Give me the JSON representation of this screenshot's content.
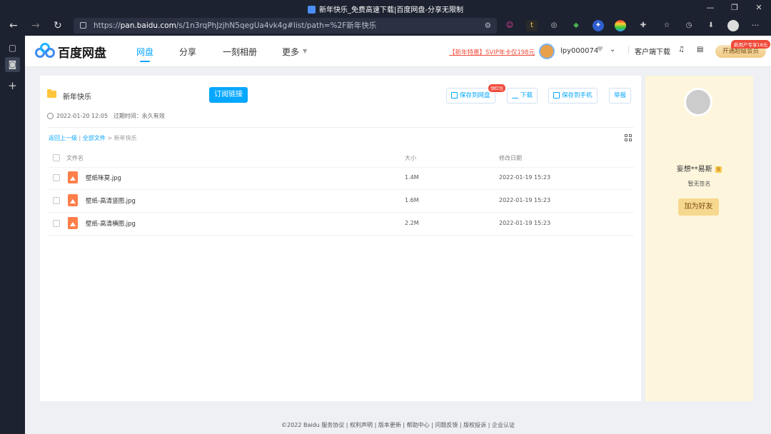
{
  "window": {
    "title": "新年快乐_免费高速下载|百度网盘-分享无限制",
    "minimize": "—",
    "restore": "❐",
    "close": "✕"
  },
  "browser": {
    "url_domain": "pan.baidu.com",
    "url_prefix": "https://",
    "url_rest": "/s/1n3rqPhJzjhN5qegUa4vk4g#list/path=%2F新年快乐",
    "back": "←",
    "forward": "→",
    "reload": "↻",
    "more": "···"
  },
  "header": {
    "brand": "百度网盘",
    "nav": [
      "网盘",
      "分享",
      "一刻相册",
      "更多"
    ],
    "promo": "【新年特惠】SVIP年卡仅198元",
    "username": "lpy000074",
    "client_download": "客户端下载",
    "vip_button": "开通超级会员",
    "vip_badge": "新用户专享18元"
  },
  "share": {
    "folder_title": "新年快乐",
    "subscribe": "订阅链接",
    "created": "2022-01-20 12:05",
    "expire_label": "过期时间：永久有效",
    "actions": {
      "save": "保存到网盘",
      "download": "下载",
      "save_phone": "保存到手机",
      "report": "举报"
    },
    "save_badge": "领红包"
  },
  "breadcrumb": {
    "back": "返回上一级",
    "all": "全部文件",
    "current": "新年快乐"
  },
  "table": {
    "headers": {
      "name": "文件名",
      "size": "大小",
      "date": "修改日期"
    },
    "rows": [
      {
        "name": "壁纸咪莫.jpg",
        "size": "1.4M",
        "date": "2022-01-19 15:23"
      },
      {
        "name": "壁纸-高清竖图.jpg",
        "size": "1.6M",
        "date": "2022-01-19 15:23"
      },
      {
        "name": "壁纸-高清横图.jpg",
        "size": "2.2M",
        "date": "2022-01-19 15:23"
      }
    ]
  },
  "sharer": {
    "name": "妄想**易斯",
    "signature": "暂无签名",
    "add_friend": "加为好友"
  },
  "footer": "©2022 Baidu  服务协议 | 权利声明 | 版本更新 | 帮助中心 | 问题反馈 | 版权投诉 | 企业认证",
  "colors": {
    "accent": "#06a7ff",
    "promo": "#f04a3a",
    "vip": "#efca84"
  }
}
